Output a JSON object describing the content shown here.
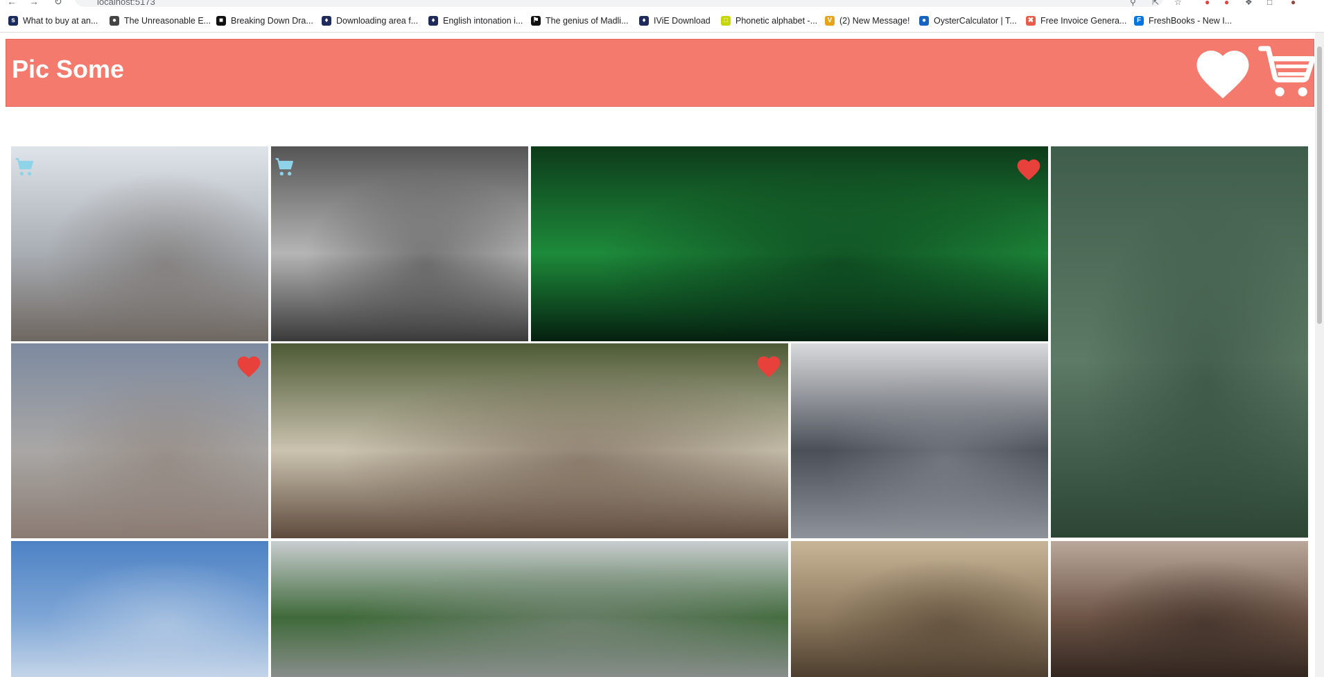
{
  "browser": {
    "url": "localhost:5173",
    "bookmarks": [
      {
        "label": "What to buy at an...",
        "icon": "sk-icon",
        "color": "#1a2b5e"
      },
      {
        "label": "The Unreasonable E...",
        "icon": "globe-icon",
        "color": "#444444"
      },
      {
        "label": "Breaking Down Dra...",
        "icon": "film-icon",
        "color": "#111111"
      },
      {
        "label": "Downloading area f...",
        "icon": "shield-icon",
        "color": "#1e2a5a"
      },
      {
        "label": "English intonation i...",
        "icon": "shield-icon",
        "color": "#1e2a5a"
      },
      {
        "label": "The genius of Madli...",
        "icon": "flag-icon",
        "color": "#111111"
      },
      {
        "label": "IViE Download",
        "icon": "shield-icon",
        "color": "#1e2a5a"
      },
      {
        "label": "Phonetic alphabet -...",
        "icon": "note-icon",
        "color": "#c5d600"
      },
      {
        "label": "(2) New Message!",
        "icon": "v-icon",
        "color": "#e8a317"
      },
      {
        "label": "OysterCalculator | T...",
        "icon": "circle-icon",
        "color": "#1565c0"
      },
      {
        "label": "Free Invoice Genera...",
        "icon": "x-icon",
        "color": "#e85d4a"
      },
      {
        "label": "FreshBooks - New I...",
        "icon": "f-icon",
        "color": "#0075dd"
      }
    ]
  },
  "app": {
    "brand": "Pic Some",
    "header_color": "#f47a6d",
    "heart_color": "#e8403a",
    "cart_color": "#8fd3e8"
  },
  "photos": [
    {
      "subject": "grizzly bear with cub on rocky snowy hillside",
      "icon": "cart",
      "colors": [
        "#dfe4ea",
        "#a8adb3",
        "#6e6660"
      ]
    },
    {
      "subject": "misty forested hills in black and white",
      "icon": "cart",
      "colors": [
        "#555555",
        "#b5b5b5",
        "#3a3a3a"
      ]
    },
    {
      "subject": "green northern lights over a tree",
      "icon": "heart",
      "colors": [
        "#0d3b1a",
        "#1d8a3a",
        "#052010"
      ]
    },
    {
      "subject": "dense green conifer branches",
      "icon": "none",
      "colors": [
        "#3f5d4b",
        "#5d7a66",
        "#2c4535"
      ]
    },
    {
      "subject": "vulture with spread wings in flight",
      "icon": "heart",
      "colors": [
        "#7d8aa0",
        "#a9a7a5",
        "#8a7b72"
      ]
    },
    {
      "subject": "dog wrapped in plaid blanket in forest",
      "icon": "heart",
      "colors": [
        "#4d5a35",
        "#cbc3b0",
        "#5e4a3c"
      ]
    },
    {
      "subject": "skyscraper seen from below",
      "icon": "none",
      "colors": [
        "#d9dadc",
        "#4a4f58",
        "#8e9299"
      ]
    },
    {
      "subject": "blue sky with clouds",
      "icon": "none",
      "colors": [
        "#4d82c4",
        "#7ea6d6",
        "#c8d7e9"
      ]
    },
    {
      "subject": "aerial view of Central Park and city",
      "icon": "none",
      "colors": [
        "#c9cdd0",
        "#3f6a3a",
        "#8c8f8f"
      ]
    },
    {
      "subject": "dead trees in foggy sepia landscape",
      "icon": "none",
      "colors": [
        "#c8b597",
        "#8d7a5f",
        "#4a3b2c"
      ]
    },
    {
      "subject": "portrait of woman with red lips",
      "icon": "none",
      "colors": [
        "#b9a89b",
        "#6d5446",
        "#2f241e"
      ]
    }
  ]
}
